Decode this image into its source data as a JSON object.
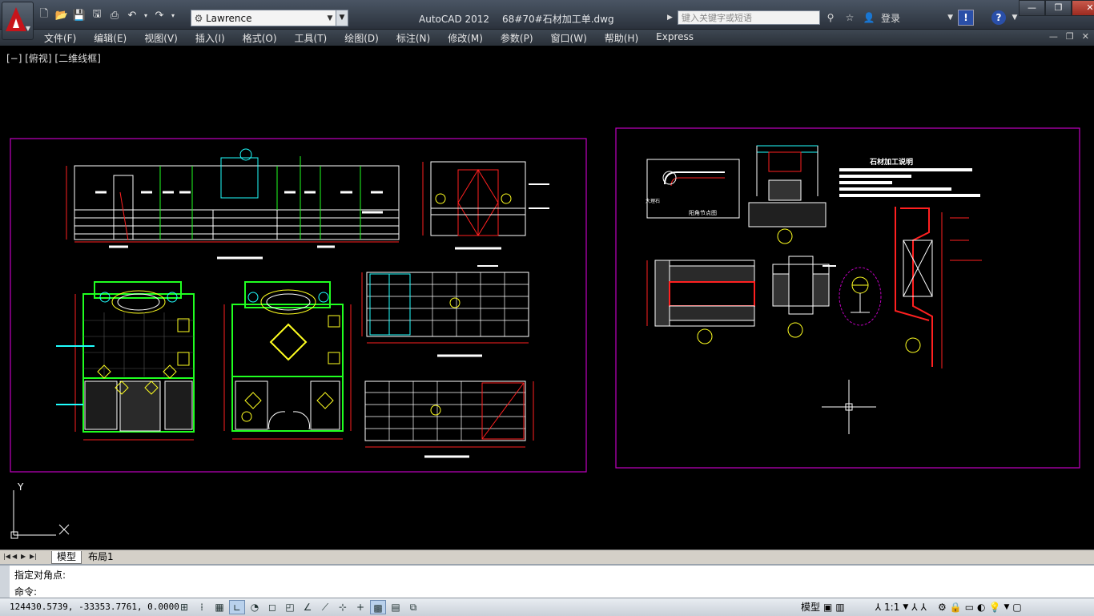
{
  "app": {
    "name": "AutoCAD 2012",
    "document": "68#70#石材加工单.dwg"
  },
  "workspace": "Lawrence",
  "search_placeholder": "键入关键字或短语",
  "login_label": "登录",
  "menu": [
    "文件(F)",
    "编辑(E)",
    "视图(V)",
    "插入(I)",
    "格式(O)",
    "工具(T)",
    "绘图(D)",
    "标注(N)",
    "修改(M)",
    "参数(P)",
    "窗口(W)",
    "帮助(H)",
    "Express"
  ],
  "viewport_label": "[−] [俯视] [二维线框]",
  "ucs": {
    "y": "Y",
    "x": "X"
  },
  "tabs": [
    "模型",
    "布局1"
  ],
  "command": {
    "prev": "指定对角点:",
    "prompt": "命令:"
  },
  "status": {
    "coords": "124430.5739, -33353.7761, 0.0000",
    "model": "模型",
    "scale": "1:1"
  },
  "drawing_text": {
    "stone_spec_title": "石材加工说明",
    "detail_title": "阳角节点图",
    "marble_label": "大理石"
  },
  "colors": {
    "frame": "#c000c0",
    "drawing_red": "#ff2020",
    "drawing_green": "#20ff20",
    "drawing_yellow": "#ffff20",
    "drawing_white": "#ffffff",
    "drawing_cyan": "#20ffff"
  }
}
